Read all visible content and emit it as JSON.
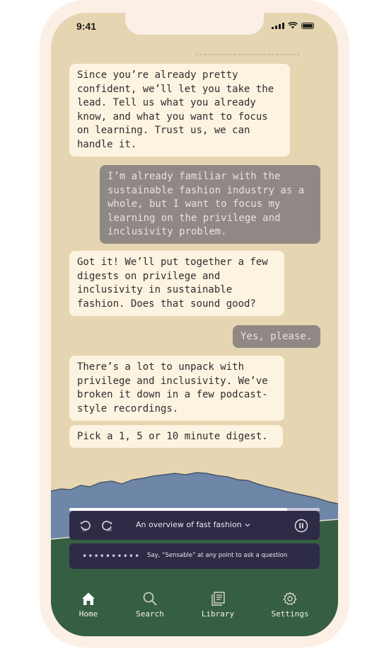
{
  "status": {
    "time": "9:41"
  },
  "messages": [
    {
      "from": "bot",
      "text": "Since you’re already pretty\nconfident, we’ll let you take the\nlead. Tell us what you already\nknow, and what you want to focus\non learning. Trust us, we can\nhandle it."
    },
    {
      "from": "user",
      "text": "I’m already familiar with the\nsustainable fashion industry as a\nwhole, but I want to focus my\nlearning on the privilege and\ninclusivity problem."
    },
    {
      "from": "bot",
      "text": "Got it! We’ll put together a few\ndigests on privilege and\ninclusivity in sustainable\nfashion. Does that sound good?"
    },
    {
      "from": "user",
      "text": "Yes, please."
    },
    {
      "from": "bot",
      "text": "There’s a lot to unpack with\nprivilege and inclusivity. We’ve\nbroken it down in a few podcast-\nstyle recordings."
    },
    {
      "from": "bot",
      "text": "Pick a 1, 5 or 10 minute digest."
    }
  ],
  "player": {
    "title": "An overview of fast fashion",
    "rewind_label": "15",
    "forward_label": "15",
    "progress": 0.87
  },
  "prompt": {
    "dots": "••••••••••",
    "hint": "Say, “Sensable” at any point to ask a question"
  },
  "tabs": [
    {
      "id": "home",
      "label": "Home",
      "icon": "home-icon"
    },
    {
      "id": "search",
      "label": "Search",
      "icon": "search-icon"
    },
    {
      "id": "library",
      "label": "Library",
      "icon": "library-icon"
    },
    {
      "id": "settings",
      "label": "Settings",
      "icon": "gear-icon"
    }
  ],
  "colors": {
    "background": "#e6d5b1",
    "bot_bubble": "#fdf3e1",
    "user_bubble": "#8f8885",
    "player": "#2e2b46",
    "mountain": "#6e86a8",
    "ground": "#365e43"
  }
}
